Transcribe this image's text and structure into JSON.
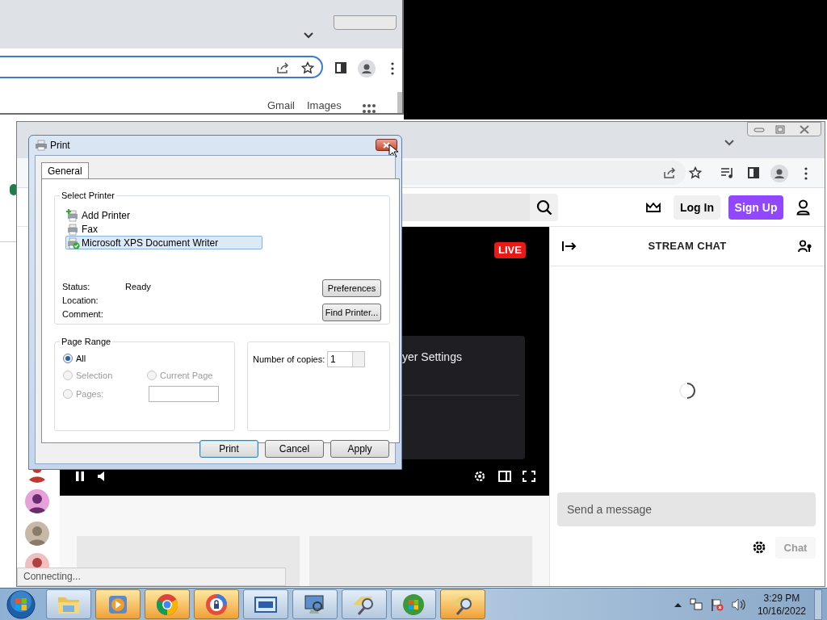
{
  "back_window": {
    "links": [
      "Gmail",
      "Images"
    ]
  },
  "browser": {
    "header": {
      "login_button": "Log In",
      "signup_button": "Sign Up"
    },
    "player": {
      "live_badge": "LIVE",
      "settings_menu_text": "yer Settings"
    },
    "chat": {
      "title": "STREAM CHAT",
      "input": {
        "placeholder": "Send a message"
      },
      "send_button": "Chat",
      "send_disabled": true
    },
    "status_bubble": "Connecting..."
  },
  "print_dialog": {
    "title": "Print",
    "tabs": [
      {
        "label": "General",
        "selected": true
      }
    ],
    "select_printer": {
      "legend": "Select Printer",
      "printers": [
        {
          "name": "Add Printer",
          "kind": "add",
          "selected": false
        },
        {
          "name": "Fax",
          "kind": "fax",
          "selected": false
        },
        {
          "name": "Microsoft XPS Document Writer",
          "kind": "default",
          "selected": true
        }
      ],
      "details": [
        {
          "label": "Status:",
          "value": "Ready"
        },
        {
          "label": "Location:"
        },
        {
          "label": "Comment:"
        }
      ],
      "buttons": [
        "Preferences",
        "Find Printer..."
      ]
    },
    "page_range": {
      "legend": "Page Range",
      "options": [
        {
          "label": "All",
          "selected": true,
          "disabled": false
        },
        {
          "label": "Selection",
          "selected": false,
          "disabled": true
        },
        {
          "label": "Current Page",
          "selected": false,
          "disabled": true
        },
        {
          "label": "Pages:",
          "selected": false,
          "disabled": true
        }
      ]
    },
    "copies": {
      "label": "Number of copies:",
      "value": "1"
    },
    "buttons": [
      {
        "label": "Print",
        "default": true
      },
      {
        "label": "Cancel",
        "default": false
      },
      {
        "label": "Apply",
        "default": false
      }
    ]
  },
  "taskbar": {
    "apps": [
      {
        "kind": "folder",
        "active": false
      },
      {
        "kind": "media",
        "active": true
      },
      {
        "kind": "chrome",
        "active": true
      },
      {
        "kind": "shield",
        "active": true
      },
      {
        "kind": "window",
        "active": false
      },
      {
        "kind": "monitor",
        "active": false
      },
      {
        "kind": "magnifier",
        "active": false
      },
      {
        "kind": "orb",
        "active": false
      },
      {
        "kind": "magnifier",
        "active": true
      }
    ],
    "clock": {
      "time": "3:29 PM",
      "date": "10/16/2022"
    }
  }
}
